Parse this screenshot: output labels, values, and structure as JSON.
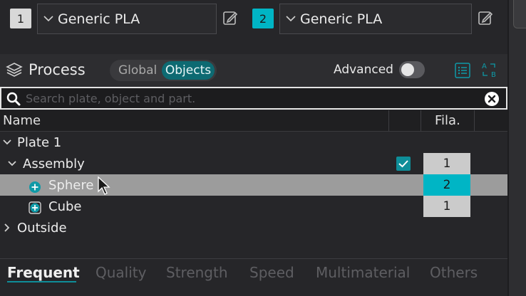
{
  "filaments": [
    {
      "index": "1",
      "name": "Generic PLA",
      "color": "#d8d8d8"
    },
    {
      "index": "2",
      "name": "Generic PLA",
      "color": "#00b5c5"
    }
  ],
  "process": {
    "title": "Process",
    "toggle_global": "Global",
    "toggle_objects": "Objects",
    "advanced_label": "Advanced",
    "advanced_on": false
  },
  "search": {
    "placeholder": "Search plate, object and part.",
    "value": ""
  },
  "table": {
    "col_name": "Name",
    "col_fila": "Fila."
  },
  "tree": {
    "plate": "Plate 1",
    "assembly": "Assembly",
    "assembly_checked": true,
    "assembly_fila": "1",
    "sphere": "Sphere",
    "sphere_fila": "2",
    "cube": "Cube",
    "cube_fila": "1",
    "outside": "Outside"
  },
  "tabs": [
    "Frequent",
    "Quality",
    "Strength",
    "Speed",
    "Multimaterial",
    "Others"
  ],
  "active_tab": "Frequent",
  "colors": {
    "accent": "#00b5c5",
    "accent_dark": "#0d6a72"
  }
}
